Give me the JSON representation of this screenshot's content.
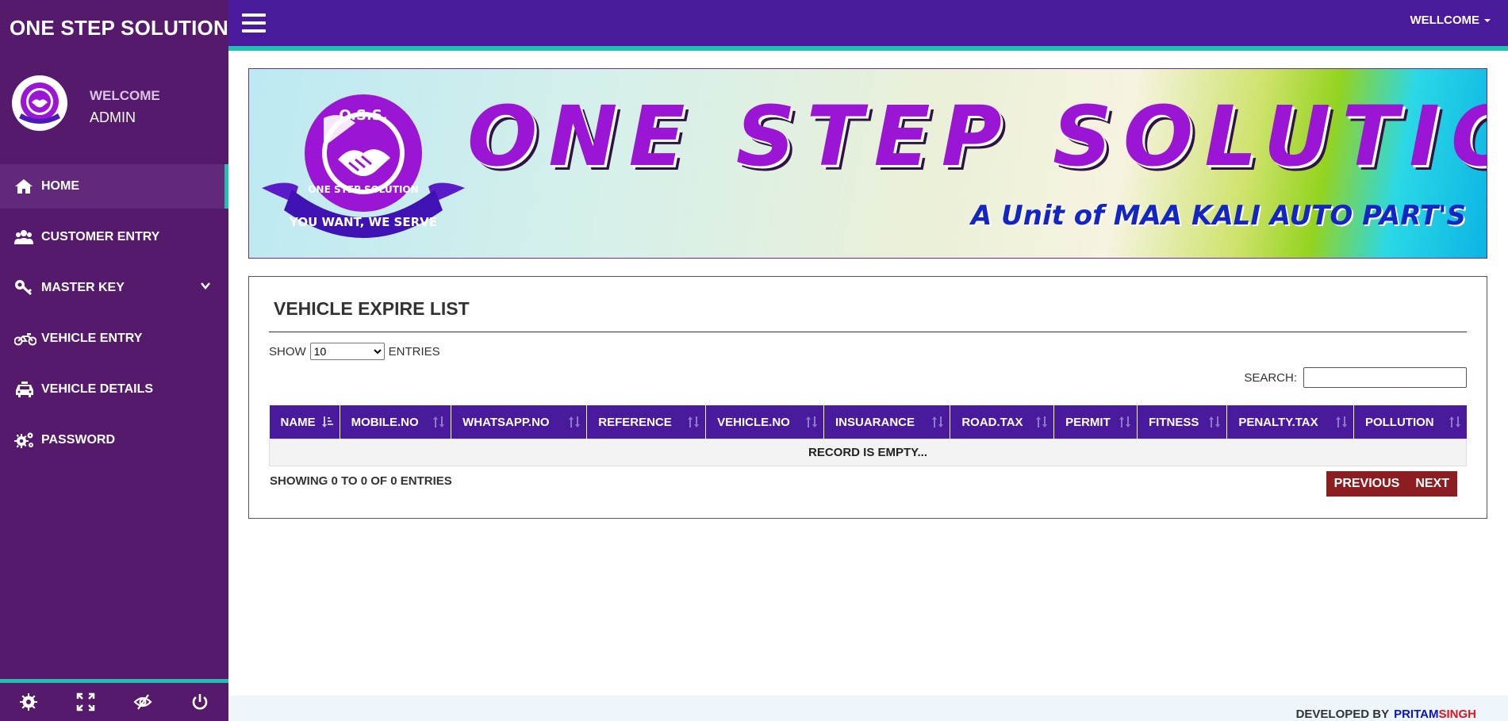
{
  "brand": "ONE STEP SOLUTION",
  "user_panel": {
    "welcome": "WELCOME",
    "name": "ADMIN"
  },
  "sidebar": {
    "items": [
      {
        "label": "HOME",
        "icon": "home-icon",
        "active": true
      },
      {
        "label": "CUSTOMER ENTRY",
        "icon": "users-icon"
      },
      {
        "label": "MASTER KEY",
        "icon": "key-icon",
        "has_submenu": true
      },
      {
        "label": "VEHICLE ENTRY",
        "icon": "motorcycle-icon"
      },
      {
        "label": "VEHICLE DETAILS",
        "icon": "taxi-icon"
      },
      {
        "label": "PASSWORD",
        "icon": "gears-icon"
      }
    ],
    "footer_icons": [
      "settings-icon",
      "fullscreen-icon",
      "hide-eye-icon",
      "power-icon"
    ]
  },
  "topbar": {
    "user_menu": "WELLCOME"
  },
  "banner": {
    "logo_top": "O.S.S.",
    "logo_ring": "ONE STEP SOLUTION",
    "logo_ribbon": "YOU WANT, WE SERVE",
    "title": "ONE STEP SOLUTION",
    "subtitle": "A Unit of MAA KALI AUTO PART'S"
  },
  "panel": {
    "title": "VEHICLE EXPIRE LIST",
    "show_label": "SHOW",
    "entries_label": "ENTRIES",
    "length_value": "10",
    "search_label": "SEARCH:",
    "search_value": "",
    "columns": [
      "NAME",
      "MOBILE.NO",
      "WHATSAPP.NO",
      "REFERENCE",
      "VEHICLE.NO",
      "INSUARANCE",
      "ROAD.TAX",
      "PERMIT",
      "FITNESS",
      "PENALTY.TAX",
      "POLLUTION"
    ],
    "empty_text": "RECORD IS EMPTY...",
    "info": "SHOWING 0 TO 0 OF 0 ENTRIES",
    "previous": "PREVIOUS",
    "next": "NEXT"
  },
  "footer": {
    "developed_by": "DEVELOPED BY",
    "name_part1": "PRITAM",
    "name_part2": "SINGH"
  },
  "colors": {
    "sidebar": "#551a6b",
    "topbar": "#4a1a9c",
    "accent": "#1fc0b0",
    "pager": "#8c1e21"
  }
}
